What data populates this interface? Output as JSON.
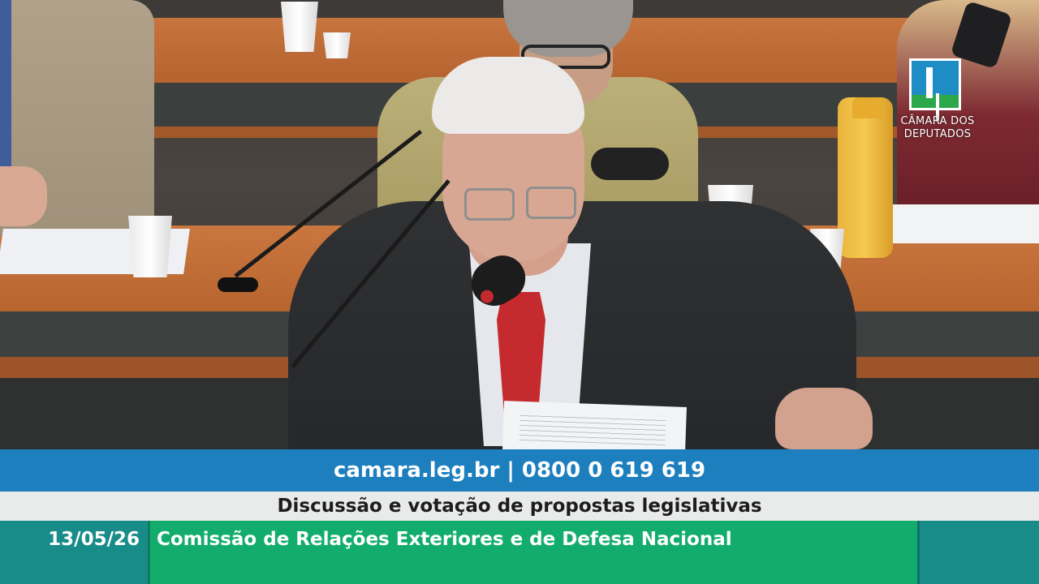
{
  "broadcast": {
    "logo": {
      "line1": "CÂMARA DOS",
      "line2": "DEPUTADOS",
      "colors": {
        "blue": "#1e8dc6",
        "green": "#2ca84a"
      }
    },
    "contact_line": "camara.leg.br | 0800 0 619 619",
    "topic": "Discussão e votação de propostas legislativas",
    "date": "13/05/26",
    "committee": "Comissão de Relações Exteriores e de Defesa Nacional"
  },
  "colors": {
    "contact_bar": "#1d7fbe",
    "topic_bar": "#e9ebea",
    "date_bar": "#178c88",
    "committee_bar": "#12ad6c"
  }
}
